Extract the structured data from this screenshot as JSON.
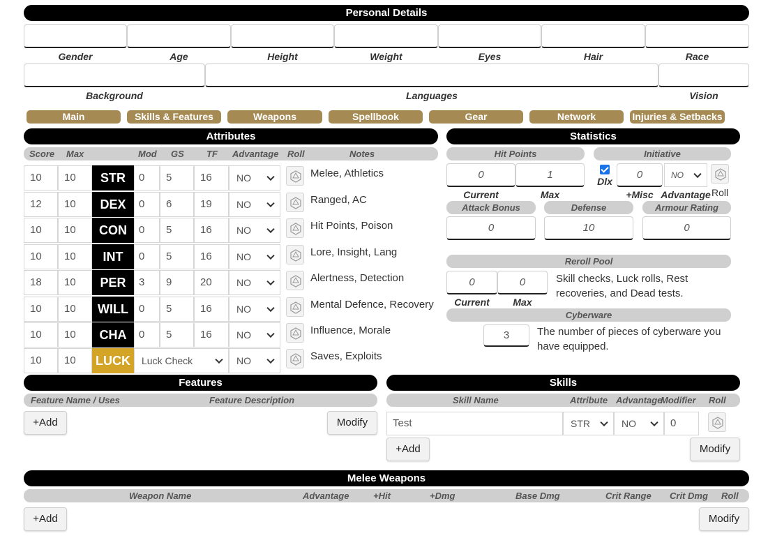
{
  "personal": {
    "title": "Personal Details",
    "labels_row1": [
      "Gender",
      "Age",
      "Height",
      "Weight",
      "Eyes",
      "Hair",
      "Race"
    ],
    "labels_row2": [
      "Background",
      "Languages",
      "Vision"
    ]
  },
  "tabs": [
    "Main",
    "Skills & Features",
    "Weapons",
    "Spellbook",
    "Gear",
    "Network",
    "Injuries & Setbacks"
  ],
  "attributes": {
    "title": "Attributes",
    "headers": {
      "score": "Score",
      "max": "Max",
      "mod": "Mod",
      "gs": "GS",
      "tf": "TF",
      "advantage": "Advantage",
      "roll": "Roll",
      "notes": "Notes"
    },
    "rows": [
      {
        "score": "10",
        "max": "10",
        "name": "STR",
        "mod": "0",
        "gs": "5",
        "tf": "16",
        "advantage": "NO",
        "notes": "Melee, Athletics"
      },
      {
        "score": "12",
        "max": "10",
        "name": "DEX",
        "mod": "0",
        "gs": "6",
        "tf": "19",
        "advantage": "NO",
        "notes": "Ranged, AC"
      },
      {
        "score": "10",
        "max": "10",
        "name": "CON",
        "mod": "0",
        "gs": "5",
        "tf": "16",
        "advantage": "NO",
        "notes": "Hit Points, Poison"
      },
      {
        "score": "10",
        "max": "10",
        "name": "INT",
        "mod": "0",
        "gs": "5",
        "tf": "16",
        "advantage": "NO",
        "notes": "Lore, Insight, Lang"
      },
      {
        "score": "18",
        "max": "10",
        "name": "PER",
        "mod": "3",
        "gs": "9",
        "tf": "20",
        "advantage": "NO",
        "notes": "Alertness, Detection"
      },
      {
        "score": "10",
        "max": "10",
        "name": "WILL",
        "mod": "0",
        "gs": "5",
        "tf": "16",
        "advantage": "NO",
        "notes": "Mental Defence, Recovery"
      },
      {
        "score": "10",
        "max": "10",
        "name": "CHA",
        "mod": "0",
        "gs": "5",
        "tf": "16",
        "advantage": "NO",
        "notes": "Influence, Morale"
      }
    ],
    "luck": {
      "score": "10",
      "max": "10",
      "name": "LUCK",
      "check": "Luck Check",
      "advantage": "NO",
      "notes": "Saves, Exploits"
    }
  },
  "statistics": {
    "title": "Statistics",
    "hit_points": {
      "label": "Hit Points",
      "current": "0",
      "max": "1",
      "current_label": "Current",
      "max_label": "Max"
    },
    "initiative": {
      "label": "Initiative",
      "dlx_label": "Dlx",
      "misc": "0",
      "misc_label": "+Misc",
      "advantage": "NO",
      "advantage_label": "Advantage",
      "roll_label": "Roll"
    },
    "attack_bonus": {
      "label": "Attack Bonus",
      "value": "0"
    },
    "defense": {
      "label": "Defense",
      "value": "10"
    },
    "armour_rating": {
      "label": "Armour Rating",
      "value": "0"
    },
    "reroll_pool": {
      "label": "Reroll Pool",
      "current": "0",
      "max": "0",
      "current_label": "Current",
      "max_label": "Max",
      "description": "Skill checks, Luck rolls, Rest recoveries, and Dead tests."
    },
    "cyberware": {
      "label": "Cyberware",
      "value": "3",
      "description": "The number of pieces of cyberware you have equipped."
    }
  },
  "features": {
    "title": "Features",
    "col_name": "Feature Name / Uses",
    "col_desc": "Feature Description",
    "add_label": "+Add",
    "modify_label": "Modify"
  },
  "skills": {
    "title": "Skills",
    "col_name": "Skill Name",
    "col_attr": "Attribute",
    "col_adv": "Advantage",
    "col_mod": "Modifier",
    "col_roll": "Roll",
    "rows": [
      {
        "name": "Test",
        "attribute": "STR",
        "advantage": "NO",
        "modifier": "0"
      }
    ],
    "add_label": "+Add",
    "modify_label": "Modify"
  },
  "melee": {
    "title": "Melee Weapons",
    "cols": [
      "Weapon Name",
      "Advantage",
      "+Hit",
      "+Dmg",
      "Base Dmg",
      "Crit Range",
      "Crit Dmg",
      "Roll"
    ],
    "add_label": "+Add",
    "modify_label": "Modify"
  },
  "colors": {
    "tab": "#a68a53",
    "luck": "#d4a427",
    "header": "#000000",
    "subheader": "#cfcfcf"
  }
}
